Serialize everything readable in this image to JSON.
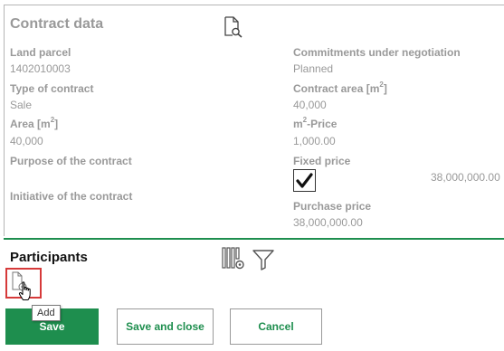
{
  "contract": {
    "title": "Contract data",
    "fields_left": [
      {
        "label": "Land parcel",
        "value": "1402010003"
      },
      {
        "label": "Type of contract",
        "value": "Sale"
      },
      {
        "label": "Area [m",
        "label_sup": "2",
        "label_end": "]",
        "value": "40,000"
      },
      {
        "label": "Purpose of the contract",
        "value": ""
      },
      {
        "label": "Initiative of the contract",
        "value": ""
      }
    ],
    "fields_right": [
      {
        "label": "Commitments under negotiation",
        "value": "Planned"
      },
      {
        "label": "Contract area [m",
        "label_sup": "2",
        "label_end": "]",
        "value": "40,000"
      },
      {
        "label_pre": "m",
        "label_sup": "2",
        "label": "-Price",
        "value": "1,000.00"
      },
      {
        "label": "Fixed price",
        "checked": true,
        "value": "38,000,000.00"
      },
      {
        "label": "Purchase price",
        "value": "38,000,000.00"
      }
    ]
  },
  "participants": {
    "title": "Participants",
    "add_tooltip": "Add"
  },
  "buttons": {
    "save": "Save",
    "save_close": "Save and close",
    "cancel": "Cancel"
  },
  "icons": {
    "contract_search": "document-search-icon",
    "settings_columns": "column-settings-icon",
    "filter": "filter-icon",
    "add_document": "add-document-icon",
    "cursor": "hand-cursor-icon",
    "check": "checkmark-icon"
  },
  "colors": {
    "accent_green": "#1e8e4e",
    "highlight_red": "#d63a3a",
    "muted_text": "#999999"
  }
}
